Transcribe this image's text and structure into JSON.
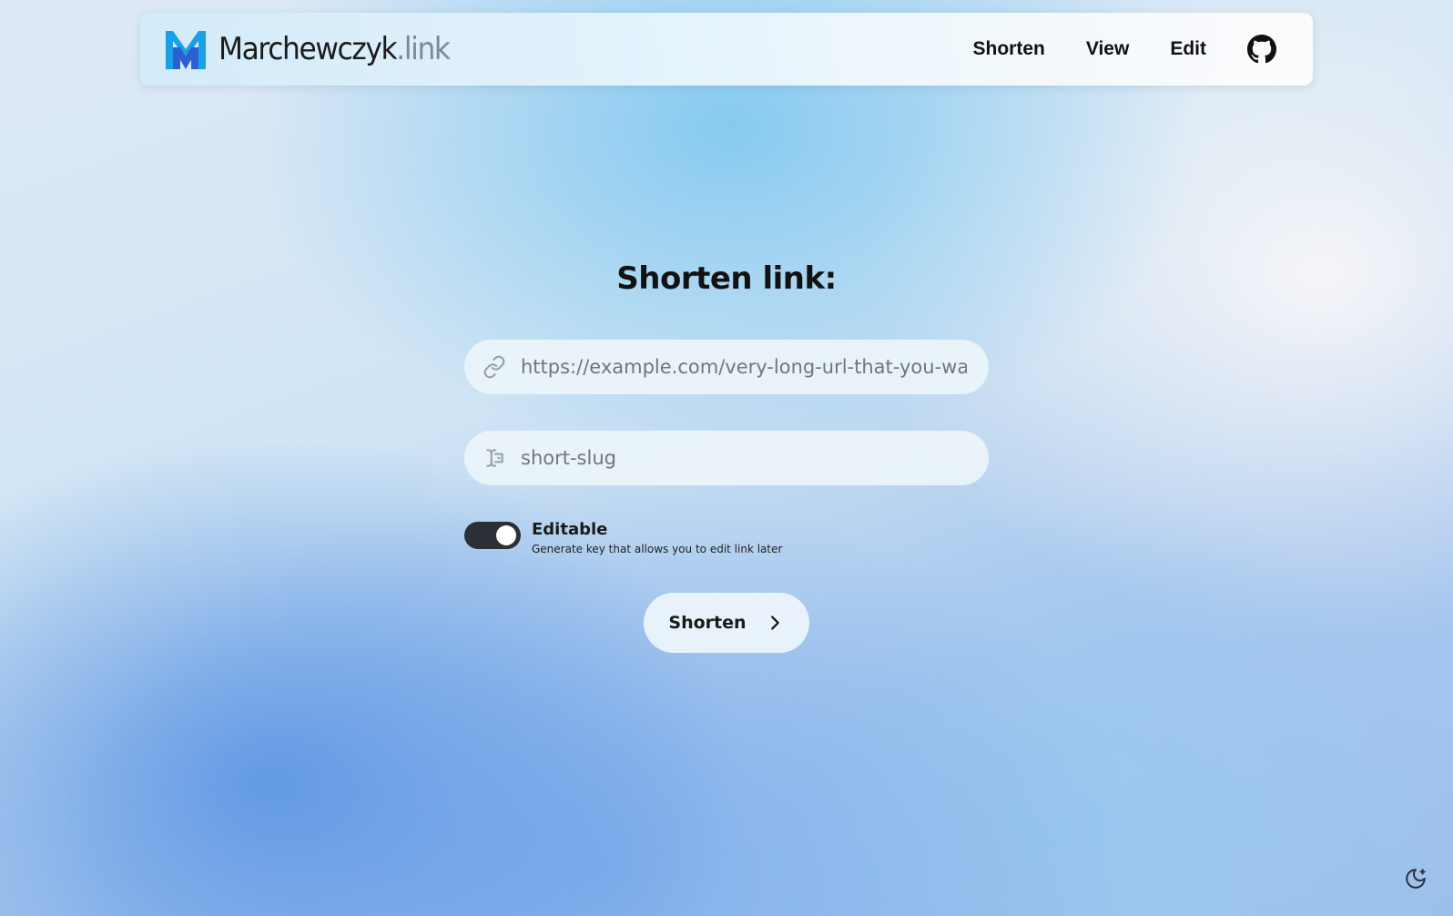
{
  "brand": {
    "name": "Marchewczyk",
    "tld": ".link",
    "accent_colors": [
      "#1aa0e6",
      "#2d5fd1"
    ]
  },
  "nav": {
    "items": [
      {
        "label": "Shorten"
      },
      {
        "label": "View"
      },
      {
        "label": "Edit"
      }
    ],
    "github_icon": "github-icon"
  },
  "main": {
    "title": "Shorten link:",
    "url_input": {
      "icon": "link-icon",
      "placeholder": "https://example.com/very-long-url-that-you-want-to-shorten"
    },
    "slug_input": {
      "icon": "text-cursor-icon",
      "placeholder": "short-slug"
    },
    "editable_toggle": {
      "label": "Editable",
      "description": "Generate key that allows you to edit link later",
      "checked": true
    },
    "submit": {
      "label": "Shorten",
      "icon": "chevron-right-icon"
    }
  },
  "footer": {
    "theme_toggle_icon": "moon-icon"
  }
}
